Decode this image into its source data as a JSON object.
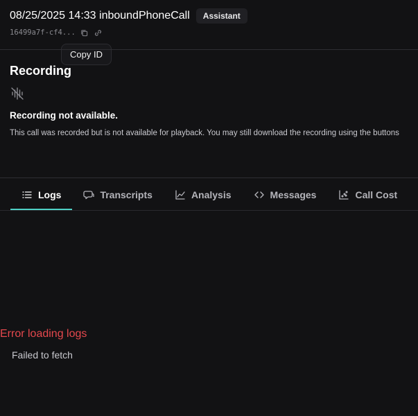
{
  "header": {
    "title": "08/25/2025 14:33 inboundPhoneCall",
    "badge": "Assistant",
    "call_id": "16499a7f-cf4...",
    "copy_icon": "copy-icon",
    "link_icon": "link-icon"
  },
  "tooltip": {
    "text": "Copy ID"
  },
  "recording": {
    "heading": "Recording",
    "icon": "audio-off-icon",
    "status": "Recording not available.",
    "description": "This call was recorded but is not available for playback. You may still download the recording using the buttons"
  },
  "tabs": [
    {
      "label": "Logs",
      "icon": "list-icon",
      "active": true
    },
    {
      "label": "Transcripts",
      "icon": "chat-bubble-icon",
      "active": false
    },
    {
      "label": "Analysis",
      "icon": "line-chart-icon",
      "active": false
    },
    {
      "label": "Messages",
      "icon": "code-icon",
      "active": false
    },
    {
      "label": "Call Cost",
      "icon": "scatter-chart-icon",
      "active": false
    },
    {
      "label": "",
      "icon": "bot-icon",
      "active": false
    }
  ],
  "logs": {
    "error_title": "Error loading logs",
    "error_message": "Failed to fetch"
  },
  "colors": {
    "background": "#121214",
    "accent": "#4fd1c5",
    "error": "#e5484d"
  }
}
